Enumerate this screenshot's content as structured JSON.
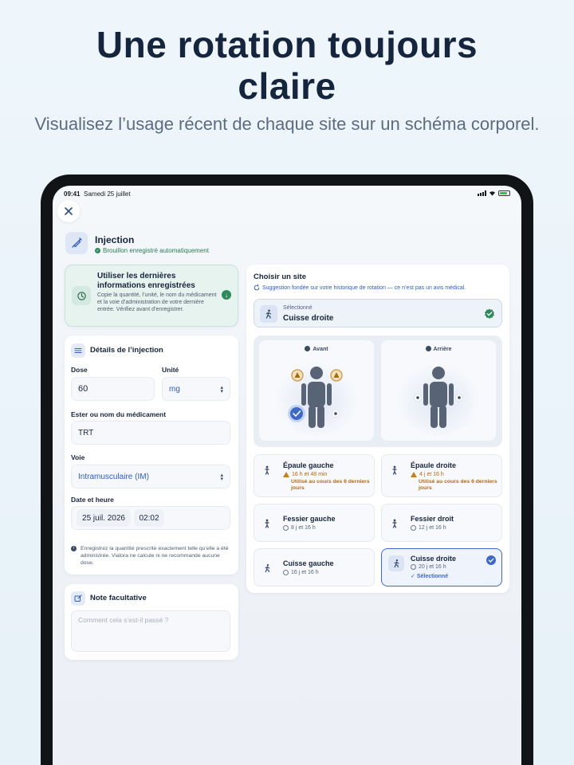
{
  "promo": {
    "title_line1": "Une rotation toujours",
    "title_line2": "claire",
    "subtitle": "Visualisez l’usage récent de chaque site sur un schéma corporel."
  },
  "status_bar": {
    "time": "09:41",
    "date": "Samedi 25 juillet"
  },
  "header": {
    "title": "Injection",
    "draft_status": "Brouillon enregistré automatiquement",
    "icon": "syringe-icon"
  },
  "reuse": {
    "title": "Utiliser les dernières informations enregistrées",
    "description": "Copie la quantité, l’unité, le nom du médicament et la voie d’administration de votre dernière entrée. Vérifiez avant d’enregistrer."
  },
  "details": {
    "title": "Détails de l’injection",
    "dose_label": "Dose",
    "dose_value": "60",
    "unit_label": "Unité",
    "unit_value": "mg",
    "medication_label": "Ester ou nom du médicament",
    "medication_value": "TRT",
    "route_label": "Voie",
    "route_value": "Intramusculaire (IM)",
    "datetime_label": "Date et heure",
    "date_value": "25 juil. 2026",
    "time_value": "02:02",
    "info_note": "Enregistrez la quantité prescrite exactement telle qu’elle a été administrée. Vialora ne calcule ni ne recommande aucune dose."
  },
  "notes": {
    "title": "Note facultative",
    "placeholder": "Comment cela s’est-il passé ?"
  },
  "site": {
    "title": "Choisir un site",
    "hint": "Suggestion fondée sur votre historique de rotation — ce n’est pas un avis médical.",
    "selected_label": "Sélectionné",
    "selected_value": "Cuisse droite",
    "front_label": "Avant",
    "back_label": "Arrière",
    "tiles": [
      {
        "name": "Épaule gauche",
        "time": "16 h et 48 min",
        "warning": "Utilisé au cours des 6 derniers jours"
      },
      {
        "name": "Épaule droite",
        "time": "4 j et 16 h",
        "warning": "Utilisé au cours des 6 derniers jours"
      },
      {
        "name": "Fessier gauche",
        "time": "8 j et 16 h"
      },
      {
        "name": "Fessier droit",
        "time": "12 j et 16 h"
      },
      {
        "name": "Cuisse gauche",
        "time": "16 j et 16 h"
      },
      {
        "name": "Cuisse droite",
        "time": "20 j et 16 h",
        "selected": "Sélectionné"
      }
    ]
  },
  "colors": {
    "accent": "#3f69c7",
    "success": "#2e8a5c",
    "warning": "#c67f1a",
    "text": "#17243b"
  }
}
